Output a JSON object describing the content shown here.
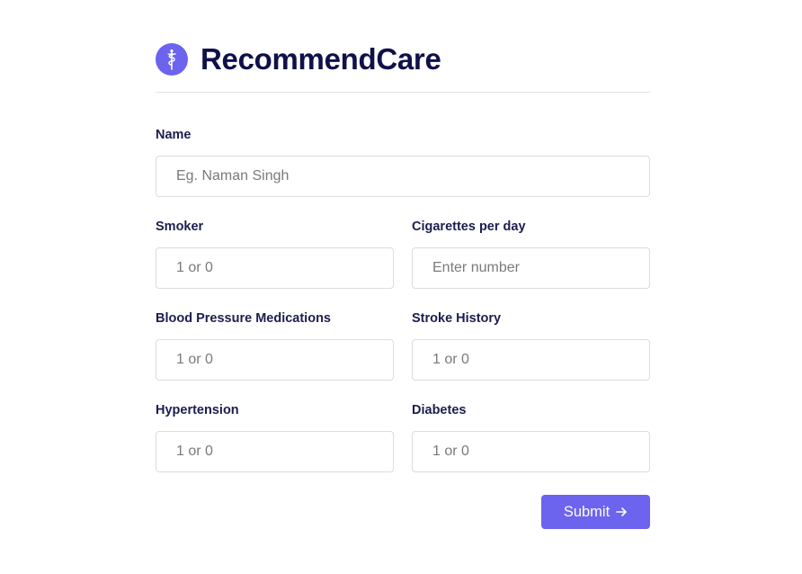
{
  "brand": {
    "title": "RecommendCare",
    "logo_icon": "caduceus-icon",
    "accent": "#6c63ef"
  },
  "form": {
    "name": {
      "label": "Name",
      "placeholder": "Eg. Naman Singh",
      "value": ""
    },
    "smoker": {
      "label": "Smoker",
      "placeholder": "1 or 0",
      "value": ""
    },
    "cigarettes": {
      "label": "Cigarettes per day",
      "placeholder": "Enter number",
      "value": ""
    },
    "bp_meds": {
      "label": "Blood Pressure Medications",
      "placeholder": "1 or 0",
      "value": ""
    },
    "stroke": {
      "label": "Stroke History",
      "placeholder": "1 or 0",
      "value": ""
    },
    "hypertension": {
      "label": "Hypertension",
      "placeholder": "1 or 0",
      "value": ""
    },
    "diabetes": {
      "label": "Diabetes",
      "placeholder": "1 or 0",
      "value": ""
    },
    "submit": {
      "label": "Submit",
      "icon": "arrow-right-icon"
    }
  }
}
